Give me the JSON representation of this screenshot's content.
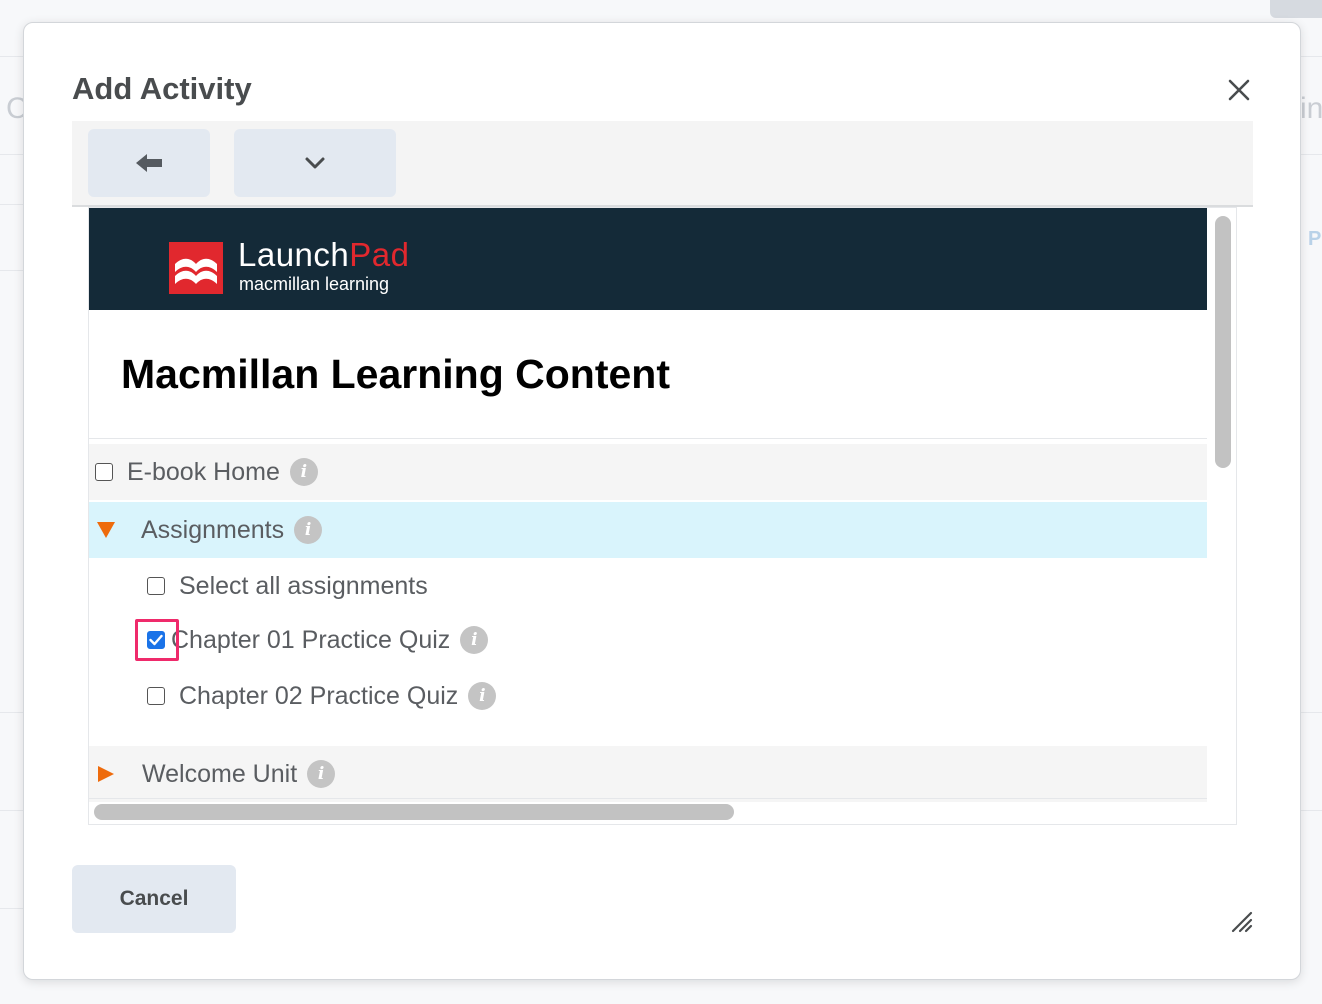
{
  "dialog": {
    "title": "Add Activity",
    "close_label": "close"
  },
  "toolbar": {
    "back_icon": "arrow-left-icon",
    "more_icon": "chevron-down-icon"
  },
  "provider": {
    "brand_launch": "Launch",
    "brand_pad": "Pad",
    "brand_sub": "macmillan learning",
    "brand_color": "#e1282e",
    "banner_color": "#142a38"
  },
  "content": {
    "title": "Macmillan Learning Content",
    "items": [
      {
        "label": "E-book Home",
        "type": "checkbox",
        "checked": false
      },
      {
        "label": "Assignments",
        "type": "expanded-folder"
      },
      {
        "label": "Select all assignments",
        "type": "checkbox",
        "checked": false
      },
      {
        "label": "Chapter 01 Practice Quiz",
        "type": "checkbox",
        "checked": true
      },
      {
        "label": "Chapter 02 Practice Quiz",
        "type": "checkbox",
        "checked": false
      },
      {
        "label": "Welcome Unit",
        "type": "collapsed-folder"
      }
    ],
    "info_icon_glyph": "i",
    "accent_color": "#ee6b0c",
    "selected_row_color": "#d9f4fc"
  },
  "footer": {
    "cancel_label": "Cancel"
  }
}
